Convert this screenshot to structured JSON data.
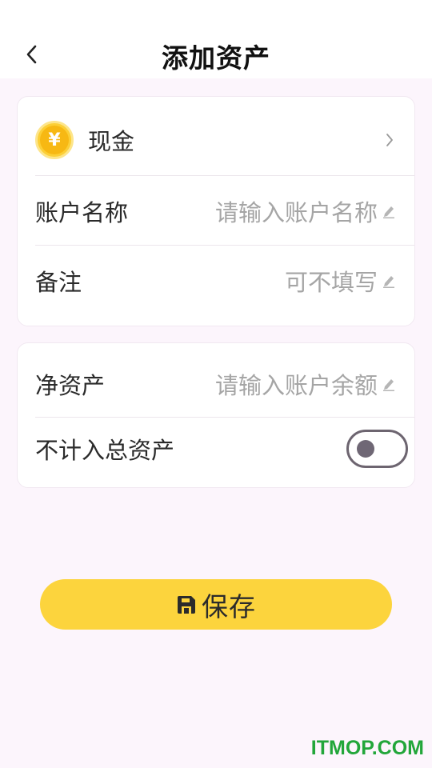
{
  "header": {
    "title": "添加资产"
  },
  "account_card": {
    "type_label": "现金",
    "type_icon": "yen-coin-icon",
    "name_label": "账户名称",
    "name_placeholder": "请输入账户名称",
    "note_label": "备注",
    "note_placeholder": "可不填写"
  },
  "asset_card": {
    "net_assets_label": "净资产",
    "net_assets_placeholder": "请输入账户余额",
    "exclude_label": "不计入总资产",
    "exclude_toggle_on": false
  },
  "save_button": {
    "label": "保存",
    "icon": "save-icon"
  },
  "watermark": "ITMOP.COM",
  "colors": {
    "accent": "#fcd43d",
    "background": "#fcf5fc",
    "placeholder": "#a5a5a5",
    "watermark": "#22a63a"
  }
}
